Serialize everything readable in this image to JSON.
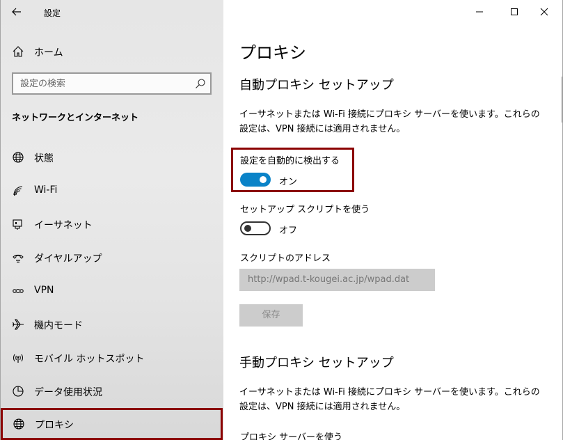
{
  "window": {
    "title": "設定",
    "minimize_glyph": "─",
    "maximize_glyph": "☐",
    "close_glyph": "✕"
  },
  "sidebar": {
    "home_label": "ホーム",
    "search_placeholder": "設定の検索",
    "section_title": "ネットワークとインターネット",
    "items": [
      {
        "label": "状態",
        "icon": "globe-status-icon"
      },
      {
        "label": "Wi-Fi",
        "icon": "wifi-icon"
      },
      {
        "label": "イーサネット",
        "icon": "ethernet-icon"
      },
      {
        "label": "ダイヤルアップ",
        "icon": "dialup-icon"
      },
      {
        "label": "VPN",
        "icon": "vpn-icon"
      },
      {
        "label": "機内モード",
        "icon": "airplane-icon"
      },
      {
        "label": "モバイル ホットスポット",
        "icon": "hotspot-icon"
      },
      {
        "label": "データ使用状況",
        "icon": "data-usage-icon"
      },
      {
        "label": "プロキシ",
        "icon": "globe-icon"
      }
    ],
    "selected_index": 8
  },
  "main": {
    "page_title": "プロキシ",
    "auto_section": {
      "title": "自動プロキシ セットアップ",
      "description": "イーサネットまたは Wi-Fi 接続にプロキシ サーバーを使います。これらの設定は、VPN 接続には適用されません。",
      "auto_detect_label": "設定を自動的に検出する",
      "auto_detect_state": "オン",
      "auto_detect_on": true,
      "setup_script_label": "セットアップ スクリプトを使う",
      "setup_script_state": "オフ",
      "setup_script_on": false,
      "script_address_label": "スクリプトのアドレス",
      "script_address_value": "http://wpad.t-kougei.ac.jp/wpad.dat",
      "save_label": "保存"
    },
    "manual_section": {
      "title": "手動プロキシ セットアップ",
      "description": "イーサネットまたは Wi-Fi 接続にプロキシ サーバーを使います。これらの設定は、VPN 接続には適用されません。",
      "use_proxy_label": "プロキシ サーバーを使う"
    }
  },
  "colors": {
    "accent": "#0a83c8",
    "highlight": "#8b0000"
  }
}
